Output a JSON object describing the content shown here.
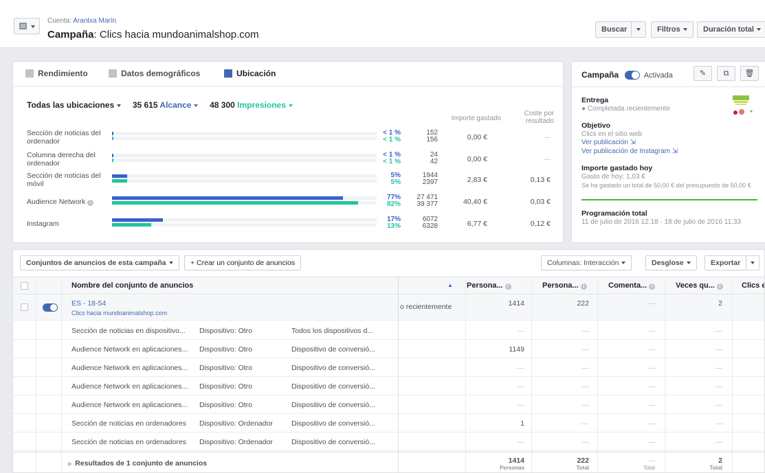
{
  "header": {
    "account_prefix": "Cuenta: ",
    "account_name": "Arantxa Marín",
    "title_prefix": "Campaña",
    "title_rest": ": Clics hacia mundoanimalshop.com",
    "buttons": {
      "search": "Buscar",
      "filters": "Filtros",
      "duration": "Duración total"
    }
  },
  "performance": {
    "tabs": [
      "Rendimiento",
      "Datos demográficos",
      "Ubicación"
    ],
    "active_tab": "Ubicación",
    "filter": {
      "placements": "Todas las ubicaciones",
      "reach_value": "35 615",
      "reach_label": "Alcance",
      "impressions_value": "48 300",
      "impressions_label": "Impresiones"
    },
    "col_spend": "Importe gastado",
    "col_cost_1": "Coste por",
    "col_cost_2": "resultado",
    "rows": [
      {
        "label": "Sección de noticias del ordenador",
        "reach_pct_text": "< 1 %",
        "impr_pct_text": "< 1 %",
        "reach_share": 0.003,
        "impr_share": 0.003,
        "reach": "152",
        "impressions": "156",
        "spend": "0,00 €",
        "cost": "—"
      },
      {
        "label": "Columna derecha del ordenador",
        "reach_pct_text": "< 1 %",
        "impr_pct_text": "< 1 %",
        "reach_share": 0.002,
        "impr_share": 0.002,
        "reach": "24",
        "impressions": "42",
        "spend": "0,00 €",
        "cost": "—"
      },
      {
        "label": "Sección de noticias del móvil",
        "reach_pct_text": "5%",
        "impr_pct_text": "5%",
        "reach_share": 0.05,
        "impr_share": 0.05,
        "reach": "1944",
        "impressions": "2397",
        "spend": "2,83 €",
        "cost": "0,13 €"
      },
      {
        "label": "Audience Network",
        "reach_pct_text": "77%",
        "impr_pct_text": "82%",
        "reach_share": 0.77,
        "impr_share": 0.82,
        "reach": "27 471",
        "impressions": "39 377",
        "spend": "40,40 €",
        "cost": "0,03 €"
      },
      {
        "label": "Instagram",
        "reach_pct_text": "17%",
        "impr_pct_text": "13%",
        "reach_share": 0.17,
        "impr_share": 0.13,
        "reach": "6072",
        "impressions": "6328",
        "spend": "6,77 €",
        "cost": "0,12 €"
      }
    ],
    "colors": {
      "reach": "#3b5fcf",
      "impressions": "#20c4a0"
    }
  },
  "side": {
    "title": "Campaña",
    "status": "Activada",
    "delivery_label": "Entrega",
    "delivery_value": "● Completada recientemente",
    "objective_label": "Objetivo",
    "objective_value": "Clics en el sitio web",
    "link_post": "Ver publicación ⇲",
    "link_instagram": "Ver publicación de Instagram ⇲",
    "spend_today_label": "Importe gastado hoy",
    "spend_today_value": "Gasto de hoy: 1,03 €",
    "spend_total_text": "Se ha gastado un total de 50,00 € del presupuesto de 50,00 €",
    "schedule_label": "Programación total",
    "schedule_value": "11 de julio de 2016 12:18 - 18 de julio de 2016 11:33"
  },
  "toolbar": {
    "adsets_dropdown": "Conjuntos de anuncios de esta campaña",
    "create_adset": "+ Crear un conjunto de anuncios",
    "columns": "Columnas: Interacción",
    "breakdown": "Desglose",
    "export": "Exportar"
  },
  "table": {
    "headers": [
      "Nombre del conjunto de anuncios",
      "Persona...",
      "Persona...",
      "Comenta...",
      "Veces qu...",
      "Clics e"
    ],
    "adset": {
      "name": "ES - 18-54",
      "subtitle": "Clics hacia mundoanimalshop.com",
      "delivery": "o recientemente",
      "c1": "1414",
      "c2": "222",
      "c3": "—",
      "c4": "2"
    },
    "rows": [
      {
        "a": "Sección de noticias en dispositivo...",
        "b": "Dispositivo: Otro",
        "c": "Todos los dispositivos d...",
        "c1": "—",
        "c2": "—",
        "c3": "—",
        "c4": "—"
      },
      {
        "a": "Audience Network en aplicaciones...",
        "b": "Dispositivo: Otro",
        "c": "Dispositivo de conversió...",
        "c1": "1149",
        "c2": "—",
        "c3": "—",
        "c4": "—"
      },
      {
        "a": "Audience Network en aplicaciones...",
        "b": "Dispositivo: Otro",
        "c": "Dispositivo de conversió...",
        "c1": "—",
        "c2": "—",
        "c3": "—",
        "c4": "—"
      },
      {
        "a": "Audience Network en aplicaciones...",
        "b": "Dispositivo: Otro",
        "c": "Dispositivo de conversió...",
        "c1": "—",
        "c2": "—",
        "c3": "—",
        "c4": "—"
      },
      {
        "a": "Audience Network en aplicaciones...",
        "b": "Dispositivo: Otro",
        "c": "Dispositivo de conversió...",
        "c1": "—",
        "c2": "—",
        "c3": "—",
        "c4": "—"
      },
      {
        "a": "Sección de noticias en ordenadores",
        "b": "Dispositivo: Ordenador",
        "c": "Dispositivo de conversió...",
        "c1": "1",
        "c2": "—",
        "c3": "—",
        "c4": "—"
      },
      {
        "a": "Sección de noticias en ordenadores",
        "b": "Dispositivo: Ordenador",
        "c": "Dispositivo de conversió...",
        "c1": "—",
        "c2": "—",
        "c3": "—",
        "c4": "—"
      }
    ],
    "footer": {
      "label": "Resultados de 1 conjunto de anuncios",
      "c1": "1414",
      "c1_sub": "Personas",
      "c2": "222",
      "c2_sub": "Total",
      "c3": "—",
      "c3_sub": "Total",
      "c4": "2",
      "c4_sub": "Total"
    }
  }
}
